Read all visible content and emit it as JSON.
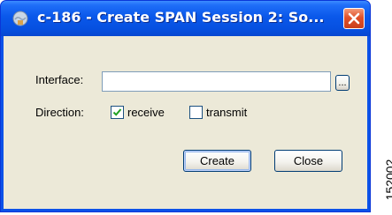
{
  "window": {
    "title": "c-186 - Create SPAN Session 2: So...",
    "title_bar_color": "#0a58ea",
    "client_bg_color": "#ece9d8",
    "app_icon": "app-globe-icon",
    "close_icon": "close-icon",
    "close_button_color": "#e0512a"
  },
  "form": {
    "interface_label": "Interface:",
    "interface_value": "",
    "browse_button_label": "...",
    "direction_label": "Direction:",
    "receive_label": "receive",
    "receive_checked": true,
    "transmit_label": "transmit",
    "transmit_checked": false
  },
  "buttons": {
    "create_label": "Create",
    "close_label": "Close"
  },
  "figure_id": "152002"
}
